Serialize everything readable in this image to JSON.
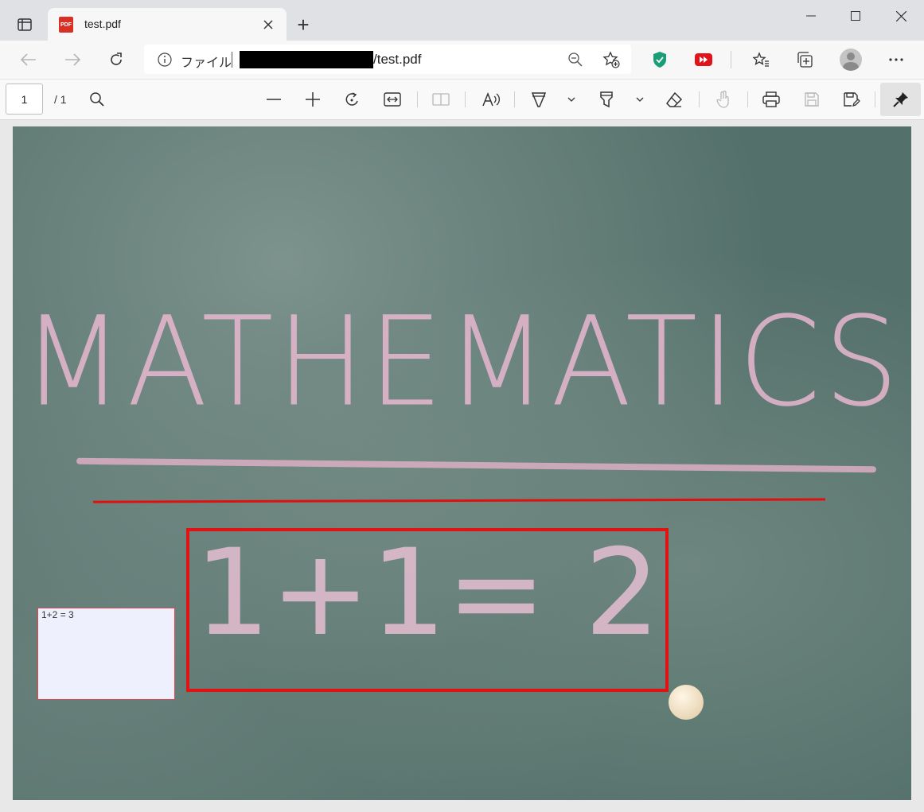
{
  "tab": {
    "title": "test.pdf",
    "favicon_label": "PDF",
    "icon": "pdf-icon"
  },
  "window": {
    "new_tab_symbol": "+",
    "buttons": [
      "minimize",
      "maximize",
      "close"
    ]
  },
  "address_bar": {
    "scheme_label": "ファイル",
    "path": "/test.pdf"
  },
  "pdf_toolbar": {
    "page_number": "1",
    "page_total": "/ 1"
  },
  "document": {
    "heading": "MATHEMATICS",
    "equation": "1+1= 2",
    "note_text": "1+2 = 3"
  },
  "colors": {
    "annotation_red": "#e21212",
    "note_background": "#eef0fe",
    "chalkboard": "#54706a",
    "chalk_pink": "#e8b8d0"
  }
}
